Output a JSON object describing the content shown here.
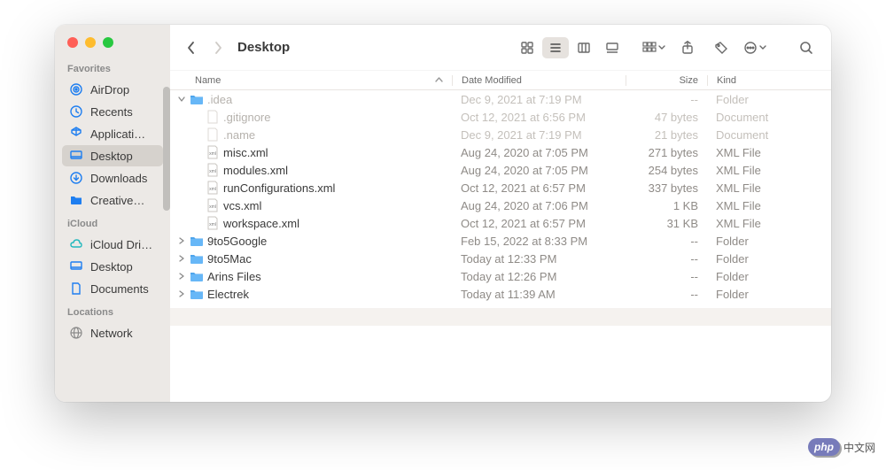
{
  "window": {
    "title": "Desktop"
  },
  "sidebar": {
    "sections": [
      {
        "label": "Favorites",
        "items": [
          {
            "icon": "airdrop",
            "label": "AirDrop",
            "active": false
          },
          {
            "icon": "clock",
            "label": "Recents",
            "active": false
          },
          {
            "icon": "apps",
            "label": "Applicati…",
            "active": false
          },
          {
            "icon": "desktop",
            "label": "Desktop",
            "active": true
          },
          {
            "icon": "download",
            "label": "Downloads",
            "active": false
          },
          {
            "icon": "folder-fill",
            "label": "Creative…",
            "active": false
          }
        ]
      },
      {
        "label": "iCloud",
        "items": [
          {
            "icon": "cloud",
            "label": "iCloud Dri…",
            "active": false
          },
          {
            "icon": "desktop",
            "label": "Desktop",
            "active": false
          },
          {
            "icon": "doc",
            "label": "Documents",
            "active": false
          }
        ]
      },
      {
        "label": "Locations",
        "items": [
          {
            "icon": "globe",
            "label": "Network",
            "active": false
          }
        ]
      }
    ]
  },
  "columns": {
    "name": "Name",
    "date": "Date Modified",
    "size": "Size",
    "kind": "Kind"
  },
  "rows": [
    {
      "indent": 0,
      "disclosure": "open",
      "icon": "folder",
      "name": ".idea",
      "date": "Dec 9, 2021 at 7:19 PM",
      "size": "--",
      "kind": "Folder",
      "dimmed": true
    },
    {
      "indent": 1,
      "disclosure": "none",
      "icon": "blank",
      "name": ".gitignore",
      "date": "Oct 12, 2021 at 6:56 PM",
      "size": "47 bytes",
      "kind": "Document",
      "dimmed": true
    },
    {
      "indent": 1,
      "disclosure": "none",
      "icon": "blank",
      "name": ".name",
      "date": "Dec 9, 2021 at 7:19 PM",
      "size": "21 bytes",
      "kind": "Document",
      "dimmed": true
    },
    {
      "indent": 1,
      "disclosure": "none",
      "icon": "xml",
      "name": "misc.xml",
      "date": "Aug 24, 2020 at 7:05 PM",
      "size": "271 bytes",
      "kind": "XML File",
      "dimmed": false
    },
    {
      "indent": 1,
      "disclosure": "none",
      "icon": "xml",
      "name": "modules.xml",
      "date": "Aug 24, 2020 at 7:05 PM",
      "size": "254 bytes",
      "kind": "XML File",
      "dimmed": false
    },
    {
      "indent": 1,
      "disclosure": "none",
      "icon": "xml",
      "name": "runConfigurations.xml",
      "date": "Oct 12, 2021 at 6:57 PM",
      "size": "337 bytes",
      "kind": "XML File",
      "dimmed": false
    },
    {
      "indent": 1,
      "disclosure": "none",
      "icon": "xml",
      "name": "vcs.xml",
      "date": "Aug 24, 2020 at 7:06 PM",
      "size": "1 KB",
      "kind": "XML File",
      "dimmed": false
    },
    {
      "indent": 1,
      "disclosure": "none",
      "icon": "xml",
      "name": "workspace.xml",
      "date": "Oct 12, 2021 at 6:57 PM",
      "size": "31 KB",
      "kind": "XML File",
      "dimmed": false
    },
    {
      "indent": 0,
      "disclosure": "closed",
      "icon": "folder",
      "name": "9to5Google",
      "date": "Feb 15, 2022 at 8:33 PM",
      "size": "--",
      "kind": "Folder",
      "dimmed": false
    },
    {
      "indent": 0,
      "disclosure": "closed",
      "icon": "folder",
      "name": "9to5Mac",
      "date": "Today at 12:33 PM",
      "size": "--",
      "kind": "Folder",
      "dimmed": false
    },
    {
      "indent": 0,
      "disclosure": "closed",
      "icon": "folder",
      "name": "Arins Files",
      "date": "Today at 12:26 PM",
      "size": "--",
      "kind": "Folder",
      "dimmed": false
    },
    {
      "indent": 0,
      "disclosure": "closed",
      "icon": "folder",
      "name": "Electrek",
      "date": "Today at 11:39 AM",
      "size": "--",
      "kind": "Folder",
      "dimmed": false
    }
  ],
  "watermark": {
    "pill": "php",
    "text": "中文网"
  }
}
